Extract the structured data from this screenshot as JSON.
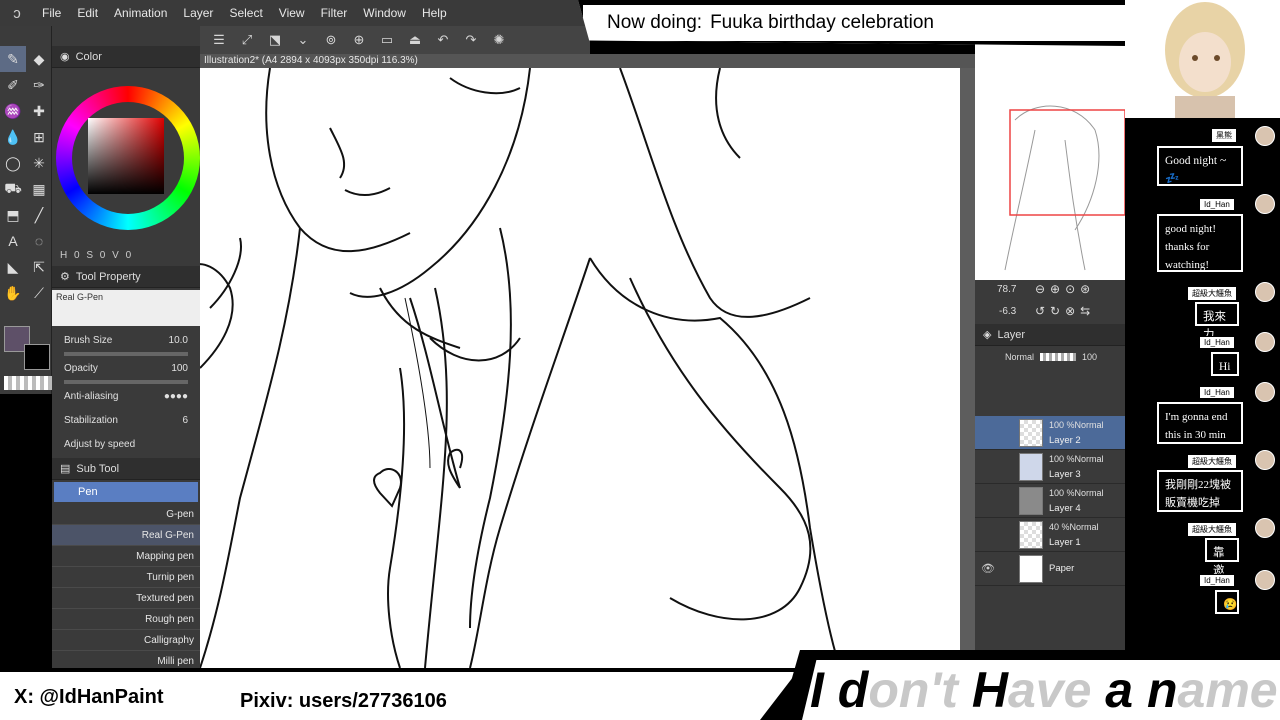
{
  "menu": {
    "items": [
      "File",
      "Edit",
      "Animation",
      "Layer",
      "Select",
      "View",
      "Filter",
      "Window",
      "Help"
    ]
  },
  "document": {
    "title": "Illustration2* (A4 2894 x 4093px 350dpi 116.3%)"
  },
  "color_panel": {
    "tab_label": "Color",
    "values": "H 0 S 0 V 0"
  },
  "tool_property": {
    "tab_label": "Tool Property",
    "preset_label": "Real G-Pen",
    "brush_size": {
      "label": "Brush Size",
      "value": "10.0"
    },
    "opacity": {
      "label": "Opacity",
      "value": "100"
    },
    "antialiasing": {
      "label": "Anti-aliasing"
    },
    "stabilization": {
      "label": "Stabilization",
      "value": "6"
    },
    "adjust_speed": {
      "label": "Adjust by speed"
    }
  },
  "sub_tool": {
    "tab_label": "Sub Tool",
    "group": "Pen",
    "brushes": [
      "G-pen",
      "Real G-Pen",
      "Mapping pen",
      "Turnip pen",
      "Textured pen",
      "Rough pen",
      "Calligraphy",
      "Milli pen"
    ]
  },
  "navigator": {
    "zoom": "78.7",
    "rotate": "-6.3"
  },
  "layer_panel": {
    "tab_label": "Layer",
    "blend_mode": "Normal",
    "opacity": "100",
    "layers": [
      {
        "opacity": "100 %",
        "mode": "Normal",
        "name": "Layer 2",
        "selected": true
      },
      {
        "opacity": "100 %",
        "mode": "Normal",
        "name": "Layer 3",
        "selected": false
      },
      {
        "opacity": "100 %",
        "mode": "Normal",
        "name": "Layer 4",
        "selected": false
      },
      {
        "opacity": "40 %",
        "mode": "Normal",
        "name": "Layer 1",
        "selected": false
      },
      {
        "opacity": "",
        "mode": "",
        "name": "Paper",
        "selected": false
      }
    ]
  },
  "stream": {
    "now_doing_label": "Now doing:",
    "now_doing_value": "Fuuka birthday celebration",
    "twitter": "X: @IdHanPaint",
    "pixiv": "Pixiv: users/27736106",
    "name_dark_1": "I d",
    "name_light_1": "on't ",
    "name_dark_2": "H",
    "name_light_2": "ave ",
    "name_dark_3": "a n",
    "name_light_3": "ame"
  },
  "chat": [
    {
      "user": "黑熊",
      "message": "Good night ~ 💤"
    },
    {
      "user": "Id_Han",
      "message": "good night! thanks for watching!"
    },
    {
      "user": "超級大鱷魚",
      "message": "我來力"
    },
    {
      "user": "Id_Han",
      "message": "Hi"
    },
    {
      "user": "Id_Han",
      "message": "I'm gonna end this in 30 min"
    },
    {
      "user": "超級大鱷魚",
      "message": "我剛剛22塊被販賣機吃掉"
    },
    {
      "user": "超級大鱷魚",
      "message": "靠邀"
    },
    {
      "user": "Id_Han",
      "message": "😢"
    }
  ]
}
